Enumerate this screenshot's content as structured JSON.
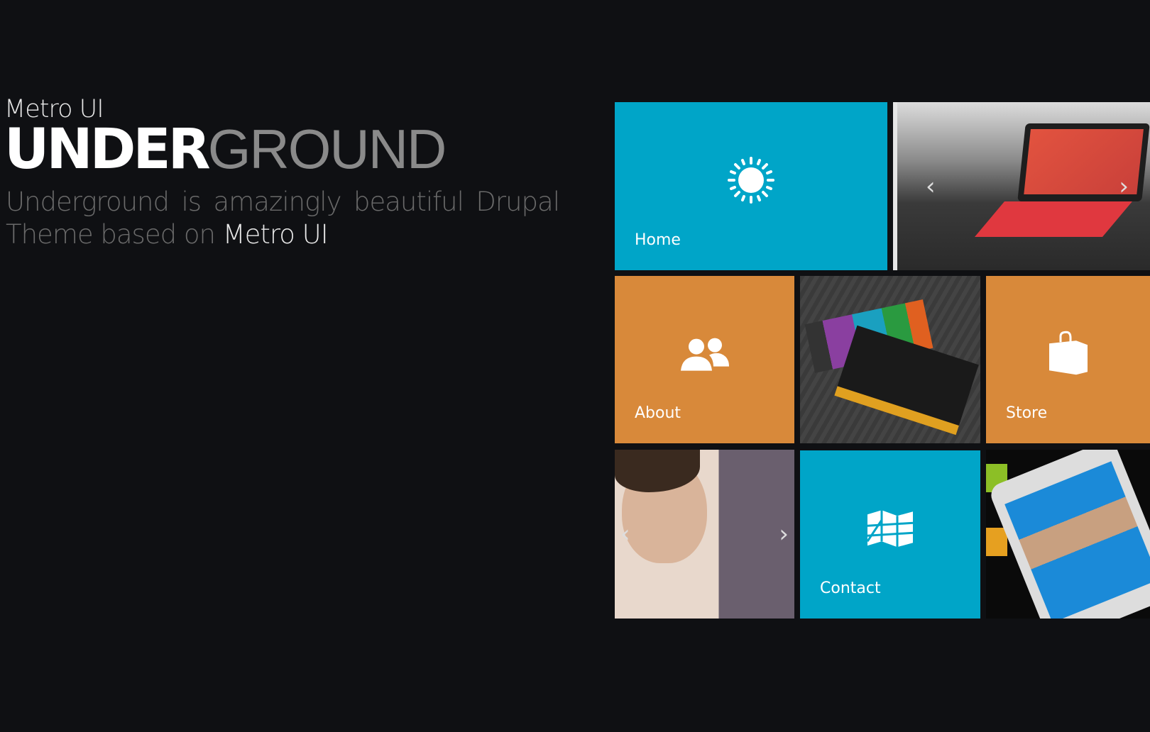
{
  "brand": {
    "small": "Metro UI",
    "big_bold": "UNDER",
    "big_light": "GROUND"
  },
  "tagline": {
    "text": "Underground is amazingly beautiful Drupal Theme based on ",
    "highlight": "Metro UI"
  },
  "tiles": [
    {
      "label": "Home",
      "icon": "sun-icon",
      "color": "#00a5c8"
    },
    {
      "label": "About",
      "icon": "users-icon",
      "color": "#d8893a"
    },
    {
      "label": "Store",
      "icon": "shopping-bag-icon",
      "color": "#d8893a"
    },
    {
      "label": "Contact",
      "icon": "map-icon",
      "color": "#00a5c8"
    }
  ],
  "slider_arrows": {
    "prev": "‹",
    "next": "›"
  }
}
